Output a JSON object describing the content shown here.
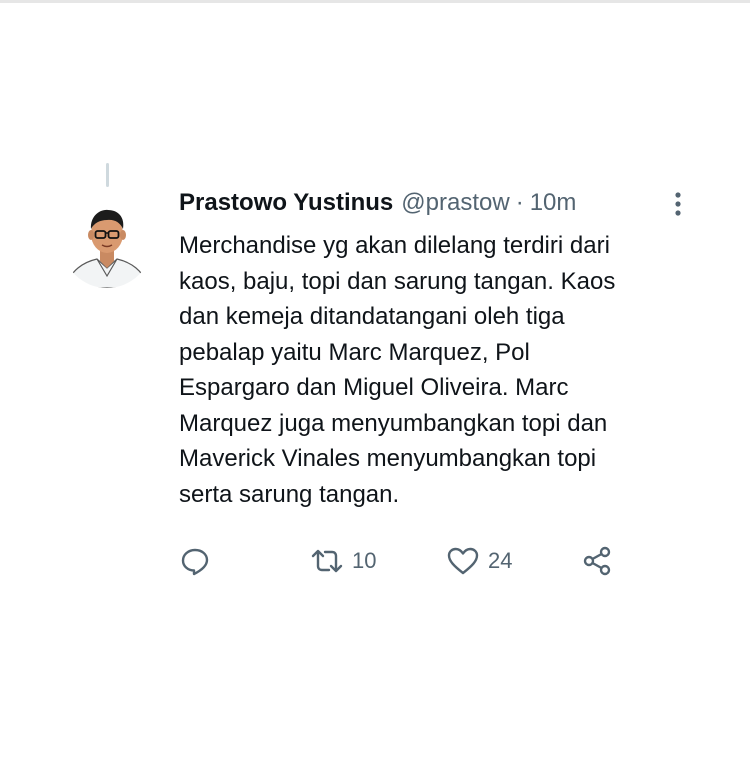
{
  "tweet": {
    "author_name": "Prastowo Yustinus",
    "handle": "@prastow",
    "separator": "·",
    "time": "10m",
    "text": "Merchandise yg akan dilelang terdiri dari\nkaos, baju, topi dan sarung tangan. Kaos\ndan kemeja ditandatangani oleh tiga\npebalap yaitu Marc Marquez, Pol\nEspargaro dan Miguel Oliveira. Marc\nMarquez juga menyumbangkan topi dan\nMaverick Vinales menyumbangkan topi\nserta sarung tangan."
  },
  "actions": {
    "reply": {
      "icon": "reply-icon"
    },
    "retweet": {
      "icon": "retweet-icon",
      "count": "10"
    },
    "like": {
      "icon": "heart-icon",
      "count": "24"
    },
    "share": {
      "icon": "share-icon"
    }
  },
  "colors": {
    "text": "#0f1419",
    "secondary": "#536471",
    "icon": "#536471",
    "thread_line": "#cfd9de"
  }
}
